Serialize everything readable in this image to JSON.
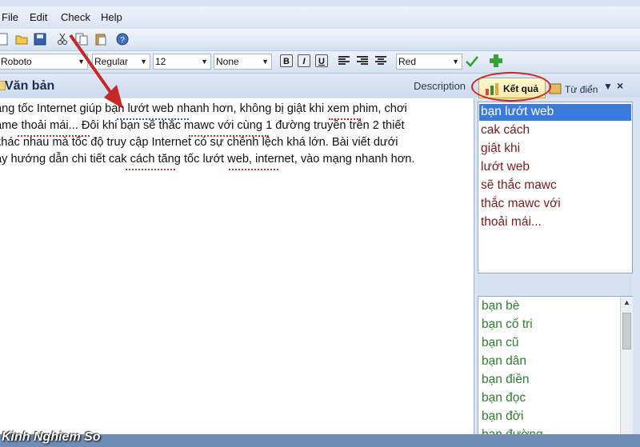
{
  "menu": {
    "file": "File",
    "edit": "Edit",
    "check": "Check",
    "help": "Help"
  },
  "format": {
    "font": "Roboto",
    "style": "Regular",
    "size": "12",
    "effect": "None",
    "bold": "B",
    "italic": "I",
    "underline": "U",
    "color": "Red"
  },
  "header": {
    "title": "Văn bản",
    "description": "Description",
    "tab_results": "Kết quả",
    "tab_dictionary": "Từ điển",
    "close": "×"
  },
  "editor": {
    "lines": [
      "ăng tốc Internet giúp bạn lướt web nhanh hơn, không bị giật khi xem phim, chơi",
      "ame thoải mái...  Đôi khi bạn sẽ thắc mawc với cùng 1 đường truyền trên 2 thiết",
      " khác nhau mà tốc độ truy cập Internet có sự chênh lệch khá lớn. Bài viết dưới",
      "ây hướng dẫn chi tiết cak cách tăng tốc lướt web, internet, vào mạng nhanh hơn."
    ]
  },
  "results": [
    "bạn lướt web",
    "cak cách",
    "giật khi",
    "lướt web",
    "sẽ thắc mawc",
    "thắc mawc với",
    "thoải mái..."
  ],
  "dictionary": [
    "bạn bè",
    "bạn cố tri",
    "bạn cũ",
    "bạn dân",
    "bạn điền",
    "bạn đọc",
    "bạn đời",
    "bạn đường"
  ],
  "watermark": "Kinh Nghiem So",
  "colors": {
    "accent": "#3b7bdc",
    "error": "#7b1c1c",
    "suggestion": "#2e7d32",
    "annotation": "#c62828"
  }
}
